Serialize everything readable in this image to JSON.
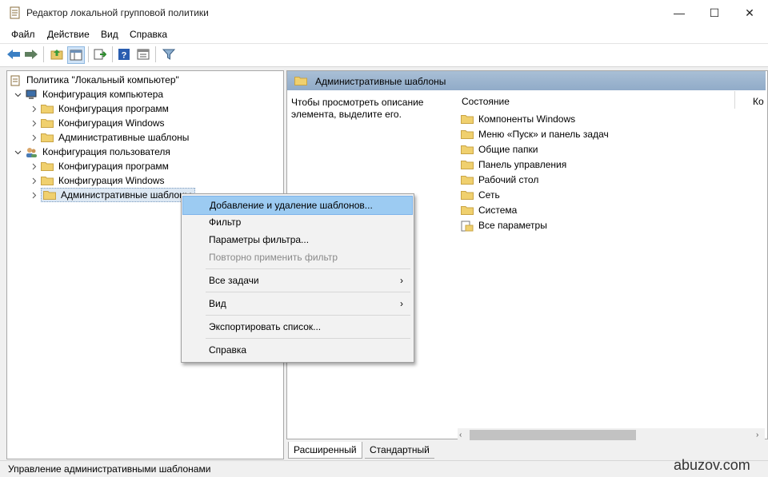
{
  "window": {
    "title": "Редактор локальной групповой политики",
    "minimize": "—",
    "maximize": "☐",
    "close": "✕"
  },
  "menu": [
    "Файл",
    "Действие",
    "Вид",
    "Справка"
  ],
  "toolbar_icons": [
    "back-icon",
    "forward-icon",
    "up-folder-icon",
    "show-hide-console-tree-icon",
    "export-list-icon",
    "help-icon",
    "properties-icon",
    "filter-icon"
  ],
  "tree": {
    "root": "Политика \"Локальный компьютер\"",
    "computer_config": "Конфигурация компьютера",
    "computer_children": [
      "Конфигурация программ",
      "Конфигурация Windows",
      "Административные шаблоны"
    ],
    "user_config": "Конфигурация пользователя",
    "user_children": [
      "Конфигурация программ",
      "Конфигурация Windows",
      "Административные шаблоны"
    ]
  },
  "right": {
    "header": "Административные шаблоны",
    "description": "Чтобы просмотреть описание элемента, выделите его.",
    "column_state": "Состояние",
    "column_comment": "Ко",
    "items": [
      "Компоненты Windows",
      "Меню «Пуск» и панель задач",
      "Общие папки",
      "Панель управления",
      "Рабочий стол",
      "Сеть",
      "Система",
      "Все параметры"
    ]
  },
  "tabs": [
    "Расширенный",
    "Стандартный"
  ],
  "context_menu": {
    "items": [
      {
        "label": "Добавление и удаление шаблонов...",
        "state": "highlighted"
      },
      {
        "label": "Фильтр",
        "state": "normal"
      },
      {
        "label": "Параметры фильтра...",
        "state": "normal"
      },
      {
        "label": "Повторно применить фильтр",
        "state": "disabled"
      },
      {
        "label": "Все задачи",
        "state": "normal",
        "submenu": true
      },
      {
        "label": "Вид",
        "state": "normal",
        "submenu": true
      },
      {
        "label": "Экспортировать список...",
        "state": "normal"
      },
      {
        "label": "Справка",
        "state": "normal"
      }
    ],
    "submenu_arrow": "›"
  },
  "status": "Управление административными шаблонами",
  "watermark": "abuzov.com",
  "colors": {
    "highlight": "#9ccbf2",
    "header_bar": "#a3bad3",
    "folder": "#e8c96a",
    "disabled_text": "#8a8a8a"
  }
}
